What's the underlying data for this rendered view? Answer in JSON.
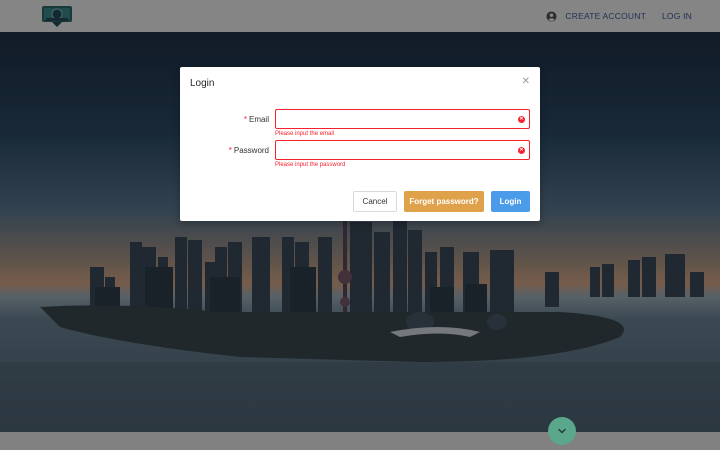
{
  "navbar": {
    "logo_icon": "city-badge-logo",
    "account_icon": "account-circle-icon",
    "create_account_label": "CREATE ACCOUNT",
    "login_label": "LOG IN"
  },
  "hero": {
    "image": "city-skyline-waterfront-at-dusk"
  },
  "scroll_button": {
    "icon": "chevron-down-icon"
  },
  "modal": {
    "title": "Login",
    "close_icon": "close-icon",
    "fields": {
      "email": {
        "label": "Email",
        "required_mark": "*",
        "value": "",
        "error": "Please input the email"
      },
      "password": {
        "label": "Password",
        "required_mark": "*",
        "value": "",
        "error": "Please input the password"
      }
    },
    "buttons": {
      "cancel": "Cancel",
      "forget": "Forget password?",
      "login": "Login"
    }
  },
  "colors": {
    "error": "#f5222d",
    "forget_button": "#dfa14a",
    "login_button": "#4a9bea",
    "scroll_button": "#5aa78c",
    "nav_link": "#3c5a96"
  }
}
